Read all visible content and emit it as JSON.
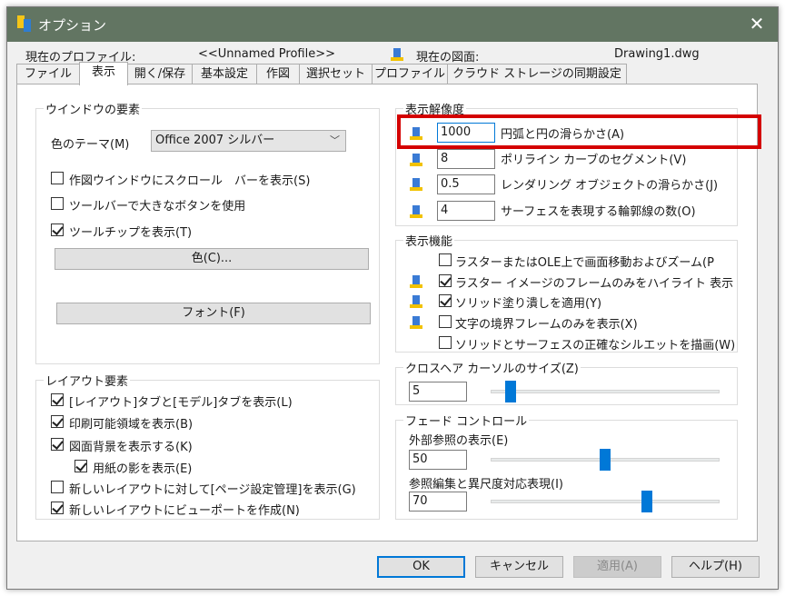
{
  "window": {
    "title": "オプション"
  },
  "profile": {
    "current_label": "現在のプロファイル:",
    "current_value": "<<Unnamed Profile>>",
    "drawing_label": "現在の図面:",
    "drawing_value": "Drawing1.dwg"
  },
  "tabs": [
    "ファイル",
    "表示",
    "開く/保存",
    "基本設定",
    "作図",
    "選択セット",
    "プロファイル",
    "クラウド ストレージの同期設定"
  ],
  "window_elements": {
    "title": "ウインドウの要素",
    "theme_label": "色のテーマ(M)",
    "theme_value": "Office 2007 シルバー",
    "options": [
      {
        "label": "作図ウインドウにスクロール　バーを表示(S)",
        "checked": false
      },
      {
        "label": "ツールバーで大きなボタンを使用",
        "checked": false
      },
      {
        "label": "ツールチップを表示(T)",
        "checked": true
      }
    ],
    "color_button": "色(C)...",
    "font_button": "フォント(F)"
  },
  "layout_elements": {
    "title": "レイアウト要素",
    "options": [
      {
        "label": "[レイアウト]タブと[モデル]タブを表示(L)",
        "checked": true
      },
      {
        "label": "印刷可能領域を表示(B)",
        "checked": true
      },
      {
        "label": "図面背景を表示する(K)",
        "checked": true
      },
      {
        "label": "用紙の影を表示(E)",
        "checked": true
      },
      {
        "label": "新しいレイアウトに対して[ページ設定管理]を表示(G)",
        "checked": false
      },
      {
        "label": "新しいレイアウトにビューポートを作成(N)",
        "checked": true
      }
    ]
  },
  "resolution": {
    "title": "表示解像度",
    "rows": [
      {
        "value": "1000",
        "label": "円弧と円の滑らかさ(A)"
      },
      {
        "value": "8",
        "label": "ポリライン カーブのセグメント(V)"
      },
      {
        "value": "0.5",
        "label": "レンダリング オブジェクトの滑らかさ(J)"
      },
      {
        "value": "4",
        "label": "サーフェスを表現する輪郭線の数(O)"
      }
    ]
  },
  "performance": {
    "title": "表示機能",
    "options": [
      {
        "label": "ラスターまたはOLE上で画面移動およびズーム(P",
        "checked": false
      },
      {
        "label": "ラスター イメージのフレームのみをハイライト 表示",
        "checked": true
      },
      {
        "label": "ソリッド塗り潰しを適用(Y)",
        "checked": true
      },
      {
        "label": "文字の境界フレームのみを表示(X)",
        "checked": false
      },
      {
        "label": "ソリッドとサーフェスの正確なシルエットを描画(W)",
        "checked": false
      }
    ]
  },
  "crosshair": {
    "title": "クロスヘア カーソルのサイズ(Z)",
    "value": "5",
    "slider_fraction": 0.05
  },
  "fade": {
    "title": "フェード コントロール",
    "xref_label": "外部参照の表示(E)",
    "xref_value": "50",
    "xref_fraction": 0.5,
    "inplace_label": "参照編集と異尺度対応表現(I)",
    "inplace_value": "70",
    "inplace_fraction": 0.7
  },
  "buttons": {
    "ok": "OK",
    "cancel": "キャンセル",
    "apply": "適用(A)",
    "help": "ヘルプ(H)"
  },
  "colors": {
    "titlebar": "#627562",
    "highlight": "#d40000",
    "accent": "#0078d7"
  }
}
